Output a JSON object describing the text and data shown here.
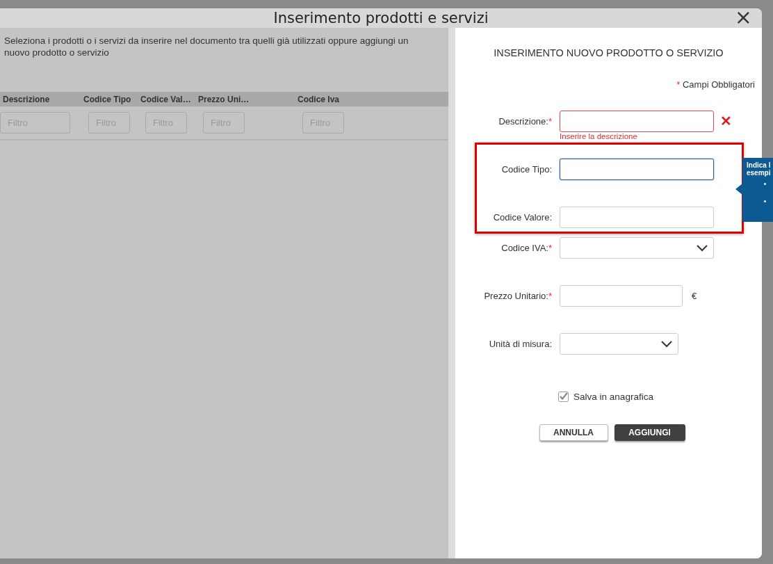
{
  "dialog": {
    "title": "Inserimento prodotti e servizi",
    "close": "×"
  },
  "list_panel": {
    "intro": "Seleziona i prodotti o i servizi da inserire nel documento tra quelli già utilizzati oppure aggiungi un nuovo prodotto o servizio",
    "columns": [
      {
        "label": "Descrizione",
        "filter_placeholder": "Filtro"
      },
      {
        "label": "Codice Tipo",
        "filter_placeholder": "Filtro"
      },
      {
        "label": "Codice Val…",
        "filter_placeholder": "Filtro"
      },
      {
        "label": "Prezzo Uni…",
        "filter_placeholder": "Filtro"
      },
      {
        "label": "Codice Iva",
        "filter_placeholder": "Filtro"
      }
    ]
  },
  "form": {
    "title": "INSERIMENTO NUOVO PRODOTTO O SERVIZIO",
    "required_mark": "*",
    "required_note": "Campi Obbligatori",
    "fields": [
      {
        "label": "Descrizione:",
        "kind": "text",
        "required": true,
        "focused": false,
        "highlighted": false,
        "error": "Inserire la descrizione",
        "error_icon": "✕"
      },
      {
        "label": "Codice Tipo:",
        "kind": "text",
        "required": false,
        "focused": true,
        "highlighted": true
      },
      {
        "label": "Codice Valore:",
        "kind": "text",
        "required": false,
        "focused": false,
        "highlighted": true
      },
      {
        "label": "Codice IVA:",
        "kind": "select",
        "required": true,
        "focused": false,
        "highlighted": false
      },
      {
        "label": "Prezzo Unitario:",
        "kind": "text",
        "required": true,
        "focused": false,
        "highlighted": false,
        "unit": "€"
      },
      {
        "label": "Unità di misura:",
        "kind": "select",
        "required": false,
        "focused": false,
        "highlighted": false
      }
    ],
    "save_checkbox": {
      "label": "Salva in anagrafica",
      "checked": true
    },
    "buttons": [
      {
        "label": "ANNULLA",
        "kind": "secondary"
      },
      {
        "label": "AGGIUNGI",
        "kind": "primary"
      }
    ]
  },
  "tooltip": {
    "lines": [
      "Indica l",
      "esempi"
    ]
  }
}
